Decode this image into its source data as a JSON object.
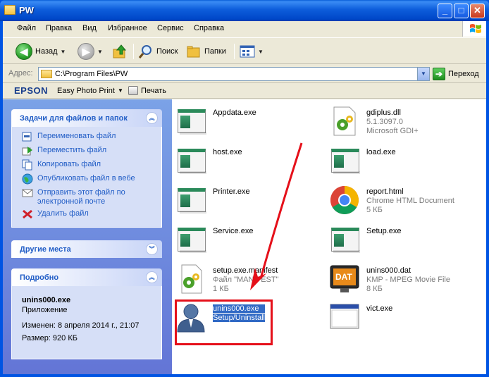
{
  "window": {
    "title": "PW",
    "buttons": {
      "minimize": "_",
      "maximize": "□",
      "close": "✕"
    }
  },
  "menu": [
    "Файл",
    "Правка",
    "Вид",
    "Избранное",
    "Сервис",
    "Справка"
  ],
  "toolbar": {
    "back": "Назад",
    "search": "Поиск",
    "folders": "Папки"
  },
  "address": {
    "label": "Адрес:",
    "value": "C:\\Program Files\\PW",
    "go": "Переход"
  },
  "epson": {
    "brand": "EPSON",
    "app": "Easy Photo Print",
    "print": "Печать"
  },
  "tasks_panel": {
    "title": "Задачи для файлов и папок",
    "items": [
      {
        "label": "Переименовать файл",
        "icon": "rename-icon"
      },
      {
        "label": "Переместить файл",
        "icon": "move-icon"
      },
      {
        "label": "Копировать файл",
        "icon": "copy-icon"
      },
      {
        "label": "Опубликовать файл в вебе",
        "icon": "globe-icon"
      },
      {
        "label": "Отправить этот файл по электронной почте",
        "icon": "email-icon"
      },
      {
        "label": "Удалить файл",
        "icon": "delete-icon"
      }
    ]
  },
  "other_places": {
    "title": "Другие места"
  },
  "details": {
    "title": "Подробно",
    "name": "unins000.exe",
    "type": "Приложение",
    "modified": "Изменен: 8 апреля 2014 г., 21:07",
    "size": "Размер: 920 КБ"
  },
  "files": [
    {
      "name": "Appdata.exe",
      "sub1": "",
      "sub2": "",
      "icon": "exe-icon"
    },
    {
      "name": "gdiplus.dll",
      "sub1": "5.1.3097.0",
      "sub2": "Microsoft GDI+",
      "icon": "dll-icon"
    },
    {
      "name": "host.exe",
      "sub1": "",
      "sub2": "",
      "icon": "exe-icon"
    },
    {
      "name": "load.exe",
      "sub1": "",
      "sub2": "",
      "icon": "exe-icon"
    },
    {
      "name": "Printer.exe",
      "sub1": "",
      "sub2": "",
      "icon": "exe-icon"
    },
    {
      "name": "report.html",
      "sub1": "Chrome HTML Document",
      "sub2": "5 КБ",
      "icon": "chrome-icon"
    },
    {
      "name": "Service.exe",
      "sub1": "",
      "sub2": "",
      "icon": "exe-icon"
    },
    {
      "name": "Setup.exe",
      "sub1": "",
      "sub2": "",
      "icon": "exe-icon"
    },
    {
      "name": "setup.exe.manifest",
      "sub1": "Файл \"MANIFEST\"",
      "sub2": "1 КБ",
      "icon": "manifest-icon"
    },
    {
      "name": "unins000.dat",
      "sub1": "KMP - MPEG Movie File",
      "sub2": "8 КБ",
      "icon": "dat-icon",
      "badge": "DAT"
    },
    {
      "name": "unins000.exe",
      "sub1": "Setup/Uninstall",
      "sub2": "",
      "icon": "user-icon",
      "selected": true
    },
    {
      "name": "vict.exe",
      "sub1": "",
      "sub2": "",
      "icon": "window-icon"
    }
  ],
  "colors": {
    "accent": "#0054e3",
    "link": "#215dc6",
    "selection": "#316ac5",
    "annotation": "#e5101a"
  }
}
